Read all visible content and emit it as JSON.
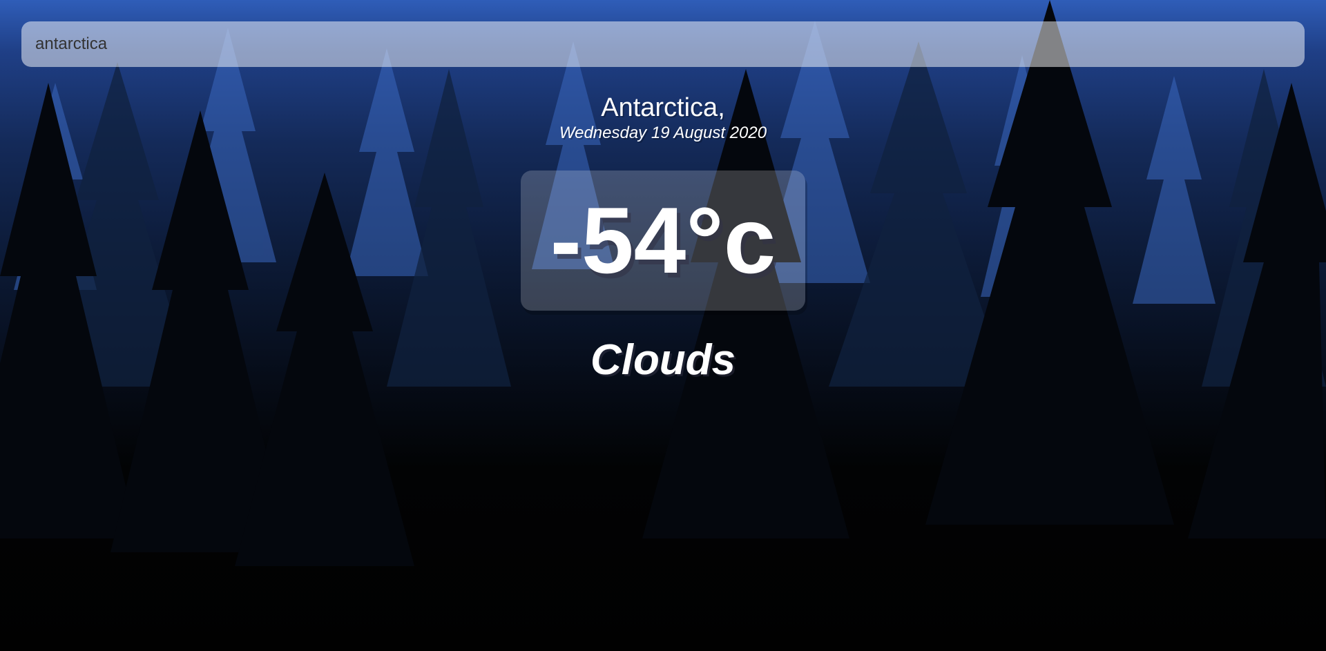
{
  "search": {
    "value": "antarctica"
  },
  "location": {
    "name": "Antarctica,",
    "date": "Wednesday 19 August 2020"
  },
  "weather": {
    "temperature": "-54°c",
    "condition": "Clouds"
  },
  "theme": {
    "sky_top": "#2f5db8",
    "night": "#010101",
    "text": "#ffffff"
  }
}
